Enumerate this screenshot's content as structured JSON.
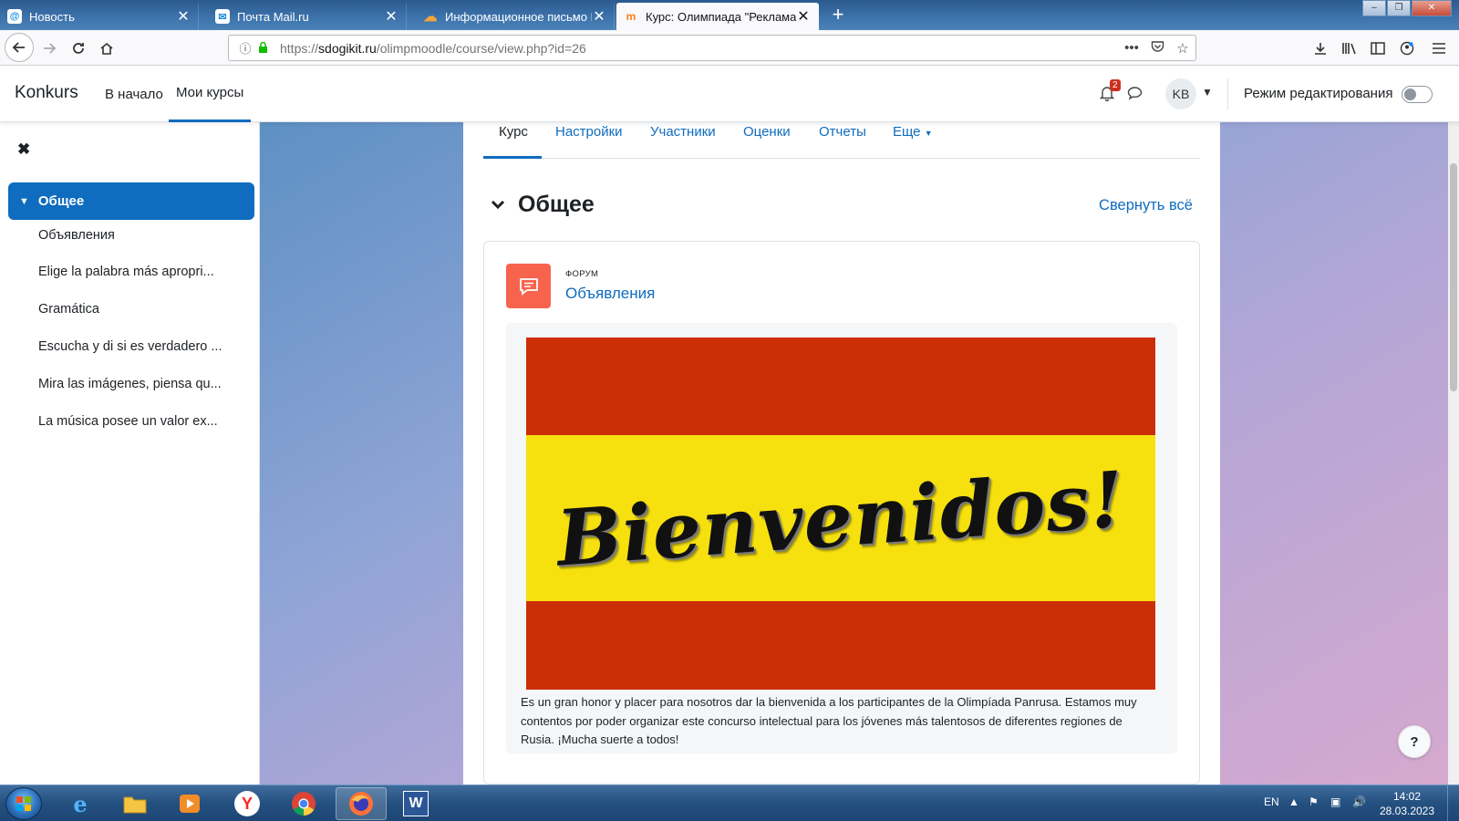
{
  "browser": {
    "tabs": [
      {
        "title": "Новость",
        "icon": "mail-at-icon"
      },
      {
        "title": "Почта Mail.ru",
        "icon": "mail-envelope-icon"
      },
      {
        "title": "Информационное письмо Вс",
        "icon": "cloud-icon"
      },
      {
        "title": "Курс: Олимпиада \"Реклама в",
        "icon": "moodle-icon"
      }
    ],
    "url_prefix": "https://",
    "url_host": "sdogikit.ru",
    "url_path": "/olimpmoodle/course/view.php?id=26"
  },
  "header": {
    "brand": "Konkurs",
    "nav": [
      "В начало",
      "Мои курсы"
    ],
    "notification_count": "2",
    "avatar_initials": "KB",
    "edit_mode_label": "Режим редактирования"
  },
  "drawer": {
    "section": "Общее",
    "items": [
      "Объявления",
      "Elige la palabra más apropri...",
      "Gramática",
      "Escucha y di si es verdadero ...",
      "Mira las imágenes, piensa qu...",
      "La música posee un valor ex..."
    ]
  },
  "course": {
    "tabs": [
      "Курс",
      "Настройки",
      "Участники",
      "Оценки",
      "Отчеты",
      "Еще"
    ],
    "section_title": "Общее",
    "collapse_all": "Свернуть всё",
    "activity": {
      "type": "ФОРУМ",
      "name": "Объявления",
      "banner_text": "Bienvenidos!",
      "description": "Es un gran honor y placer para nosotros dar la bienvenida a los participantes de la Olimpíada Panrusa. Estamos muy contentos por poder organizar este concurso intelectual para los jóvenes más talentosos de diferentes regiones de Rusia. ¡Mucha suerte a todos!"
    },
    "help": "?"
  },
  "taskbar": {
    "language": "EN",
    "time": "14:02",
    "date": "28.03.2023"
  },
  "colors": {
    "primary": "#0f6cbf",
    "forum_icon": "#f7634d",
    "flag_red": "#cc2e05",
    "flag_yellow": "#f6e10f"
  }
}
